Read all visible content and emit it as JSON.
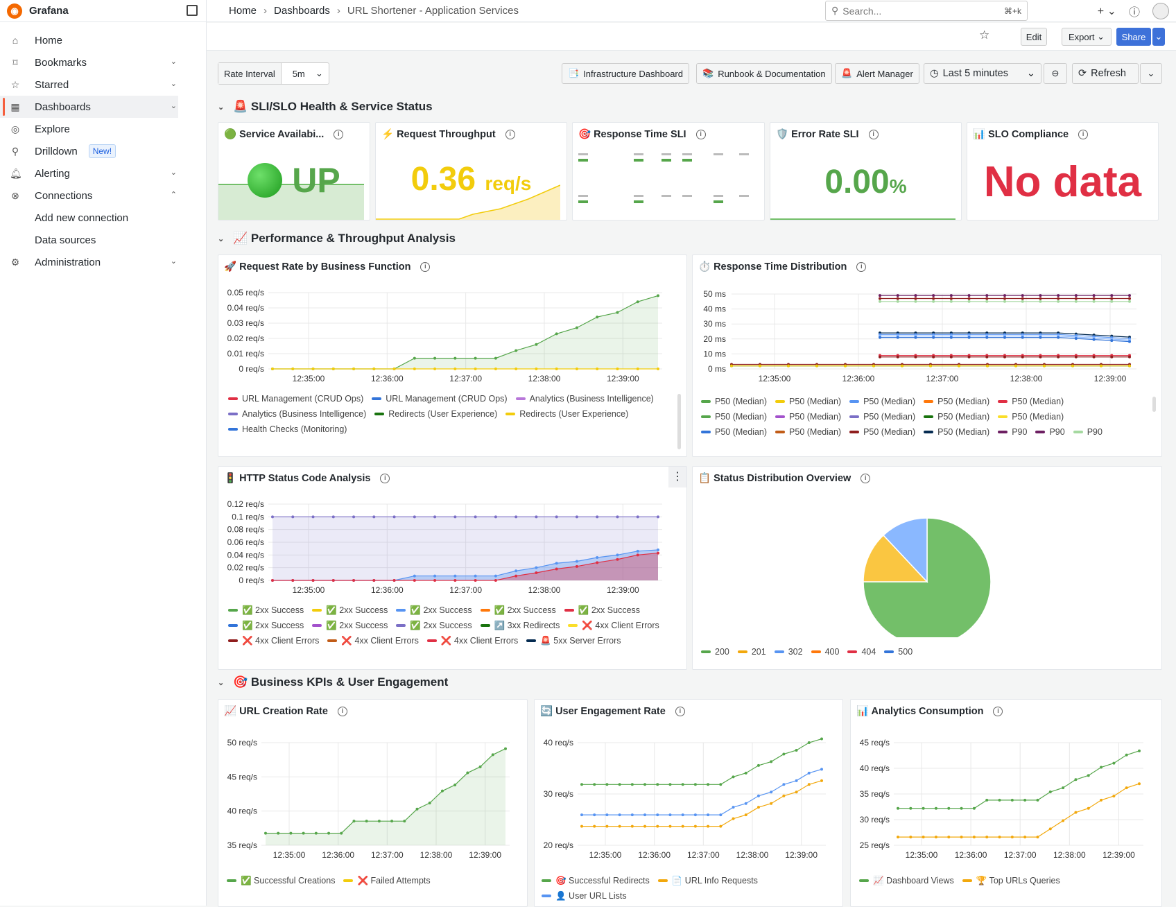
{
  "app": {
    "name": "Grafana"
  },
  "sidebar": {
    "items": [
      {
        "label": "Home",
        "icon": "home-icon"
      },
      {
        "label": "Bookmarks",
        "icon": "bookmark-icon"
      },
      {
        "label": "Starred",
        "icon": "star-icon"
      },
      {
        "label": "Dashboards",
        "icon": "dashboards-icon"
      },
      {
        "label": "Explore",
        "icon": "compass-icon"
      },
      {
        "label": "Drilldown",
        "icon": "drilldown-icon",
        "badge": "New!"
      },
      {
        "label": "Alerting",
        "icon": "bell-icon"
      },
      {
        "label": "Connections",
        "icon": "connections-icon"
      },
      {
        "label": "Add new connection"
      },
      {
        "label": "Data sources"
      },
      {
        "label": "Administration",
        "icon": "gear-icon"
      }
    ]
  },
  "breadcrumb": {
    "home": "Home",
    "dashboards": "Dashboards",
    "current": "URL Shortener - Application Services"
  },
  "search": {
    "placeholder": "Search...",
    "shortcut": "⌘+k"
  },
  "toolbar": {
    "edit": "Edit",
    "export": "Export",
    "share": "Share"
  },
  "vars": {
    "rate_label": "Rate Interval",
    "rate_value": "5m"
  },
  "links": {
    "infra": "Infrastructure Dashboard",
    "runbook": "Runbook & Documentation",
    "alert": "Alert Manager"
  },
  "time": {
    "range": "Last 5 minutes",
    "refresh": "Refresh"
  },
  "rows": {
    "r1": "🚨 SLI/SLO Health & Service Status",
    "r2": "📈 Performance & Throughput Analysis",
    "r3": "🎯 Business KPIs & User Engagement"
  },
  "stats": {
    "availability": {
      "title": "🟢 Service Availabi...",
      "value": "UP"
    },
    "throughput": {
      "title": "⚡ Request Throughput",
      "value": "0.36",
      "unit": "req/s"
    },
    "response": {
      "title": "🎯 Response Time SLI"
    },
    "error": {
      "title": "🛡️ Error Rate SLI",
      "value": "0.00",
      "unit": "%"
    },
    "slo": {
      "title": "📊 SLO Compliance",
      "value": "No data"
    }
  },
  "panels": {
    "reqrate": {
      "title": "🚀 Request Rate by Business Function"
    },
    "resp": {
      "title": "⏱️ Response Time Distribution"
    },
    "http": {
      "title": "🚦 HTTP Status Code Analysis"
    },
    "statusdist": {
      "title": "📋 Status Distribution Overview"
    },
    "urlcreate": {
      "title": "📈 URL Creation Rate"
    },
    "engagement": {
      "title": "🔄 User Engagement Rate"
    },
    "analytics": {
      "title": "📊 Analytics Consumption"
    }
  },
  "colors": {
    "green": "#56a64b",
    "yellow": "#f2cc0c",
    "blue": "#5794f2",
    "red": "#e02f44",
    "orange": "#ff780a",
    "purple": "#b877d9",
    "darkred": "#8f1d1d",
    "lightgreen": "#96d98d"
  },
  "chart_data": [
    {
      "id": "reqrate",
      "type": "line",
      "x": [
        "12:35:00",
        "12:36:00",
        "12:37:00",
        "12:38:00",
        "12:39:00"
      ],
      "yticks": [
        "0.05 req/s",
        "0.04 req/s",
        "0.03 req/s",
        "0.02 req/s",
        "0.01 req/s",
        "0 req/s"
      ],
      "ylim": [
        0,
        0.05
      ],
      "series": [
        {
          "values": [
            0,
            0,
            0,
            0,
            0,
            0,
            0,
            0.007,
            0.007,
            0.007,
            0.007,
            0.007,
            0.012,
            0.016,
            0.023,
            0.027,
            0.034,
            0.037,
            0.044,
            0.048
          ],
          "color": "#56a64b"
        },
        {
          "values": [
            0,
            0,
            0,
            0,
            0,
            0,
            0,
            0,
            0,
            0,
            0,
            0,
            0,
            0,
            0,
            0,
            0,
            0,
            0,
            0
          ],
          "color": "#f2cc0c"
        }
      ],
      "legend": [
        "URL Management (CRUD Ops)",
        "URL Management (CRUD Ops)",
        "Analytics (Business Intelligence)",
        "Analytics (Business Intelligence)",
        "Redirects (User Experience)",
        "Redirects (User Experience)",
        "Health Checks (Monitoring)"
      ]
    },
    {
      "id": "resp",
      "type": "line",
      "x": [
        "12:35:00",
        "12:36:00",
        "12:37:00",
        "12:38:00",
        "12:39:00"
      ],
      "yticks": [
        "50 ms",
        "40 ms",
        "30 ms",
        "20 ms",
        "10 ms",
        "0 ms"
      ],
      "ylim": [
        0,
        50
      ],
      "legend": [
        "P50 (Median)",
        "P50 (Median)",
        "P50 (Median)",
        "P50 (Median)",
        "P50 (Median)",
        "P50 (Median)",
        "P50 (Median)",
        "P50 (Median)",
        "P50 (Median)",
        "P50 (Median)",
        "P50 (Median)",
        "P50 (Median)",
        "P50 (Median)",
        "P50 (Median)",
        "P90",
        "P90",
        "P90"
      ]
    },
    {
      "id": "http",
      "type": "area",
      "x": [
        "12:35:00",
        "12:36:00",
        "12:37:00",
        "12:38:00",
        "12:39:00"
      ],
      "yticks": [
        "0.12 req/s",
        "0.1 req/s",
        "0.08 req/s",
        "0.06 req/s",
        "0.04 req/s",
        "0.02 req/s",
        "0 req/s"
      ],
      "ylim": [
        0,
        0.12
      ],
      "series": [
        {
          "name": "2xx Success",
          "values": [
            0.1,
            0.1,
            0.1,
            0.1,
            0.1,
            0.1,
            0.1,
            0.1,
            0.1,
            0.1,
            0.1,
            0.1,
            0.1,
            0.1,
            0.1,
            0.1,
            0.1,
            0.1,
            0.1,
            0.1
          ],
          "color": "#7b6fc6"
        },
        {
          "name": "2xx Success",
          "values": [
            0,
            0,
            0,
            0,
            0,
            0,
            0,
            0.007,
            0.007,
            0.007,
            0.007,
            0.007,
            0.015,
            0.02,
            0.027,
            0.03,
            0.036,
            0.04,
            0.046,
            0.048
          ],
          "color": "#5794f2"
        },
        {
          "name": "4xx Client Errors",
          "values": [
            0,
            0,
            0,
            0,
            0,
            0,
            0,
            0,
            0,
            0,
            0,
            0,
            0.007,
            0.012,
            0.018,
            0.022,
            0.028,
            0.033,
            0.04,
            0.043
          ],
          "color": "#e02f44"
        }
      ],
      "legend": [
        "✅ 2xx Success",
        "✅ 2xx Success",
        "✅ 2xx Success",
        "✅ 2xx Success",
        "✅ 2xx Success",
        "✅ 2xx Success",
        "✅ 2xx Success",
        "✅ 2xx Success",
        "↗️ 3xx Redirects",
        "❌ 4xx Client Errors",
        "❌ 4xx Client Errors",
        "❌ 4xx Client Errors",
        "❌ 4xx Client Errors",
        "🚨 5xx Server Errors"
      ]
    },
    {
      "id": "statusdist",
      "type": "pie",
      "slices": [
        {
          "label": "200",
          "value": 75,
          "color": "#73bf69"
        },
        {
          "label": "201",
          "value": 13,
          "color": "#fac641"
        },
        {
          "label": "302",
          "value": 12,
          "color": "#8ab8ff"
        }
      ],
      "legend": [
        "200",
        "201",
        "302",
        "400",
        "404",
        "500"
      ]
    },
    {
      "id": "urlcreate",
      "type": "line",
      "x": [
        "12:35:00",
        "12:36:00",
        "12:37:00",
        "12:38:00",
        "12:39:00"
      ],
      "yticks": [
        "50 req/s",
        "45 req/s",
        "40 req/s",
        "35 req/s"
      ],
      "ylim": [
        34,
        51
      ],
      "series": [
        {
          "name": "✅ Successful Creations",
          "values": [
            36,
            36,
            36,
            36,
            36,
            36,
            36,
            38,
            38,
            38,
            38,
            38,
            40,
            41,
            43,
            44,
            46,
            47,
            49,
            50
          ],
          "color": "#56a64b"
        }
      ],
      "legend": [
        "✅ Successful Creations",
        "❌ Failed Attempts"
      ]
    },
    {
      "id": "engagement",
      "type": "line",
      "x": [
        "12:35:00",
        "12:36:00",
        "12:37:00",
        "12:38:00",
        "12:39:00"
      ],
      "yticks": [
        "40 req/s",
        "30 req/s",
        "20 req/s"
      ],
      "ylim": [
        18,
        45
      ],
      "series": [
        {
          "name": "🎯 Successful Redirects",
          "values": [
            34,
            34,
            34,
            34,
            34,
            34,
            34,
            34,
            34,
            34,
            34,
            34,
            36,
            37,
            39,
            40,
            42,
            43,
            45,
            46
          ],
          "color": "#56a64b"
        },
        {
          "name": "👤 User URL Lists",
          "values": [
            26,
            26,
            26,
            26,
            26,
            26,
            26,
            26,
            26,
            26,
            26,
            26,
            28,
            29,
            31,
            32,
            34,
            35,
            37,
            38
          ],
          "color": "#5794f2"
        },
        {
          "name": "📄 URL Info Requests",
          "values": [
            23,
            23,
            23,
            23,
            23,
            23,
            23,
            23,
            23,
            23,
            23,
            23,
            25,
            26,
            28,
            29,
            31,
            32,
            34,
            35
          ],
          "color": "#f2a80c"
        }
      ],
      "legend": [
        "🎯 Successful Redirects",
        "📄 URL Info Requests",
        "👤 User URL Lists"
      ]
    },
    {
      "id": "analytics",
      "type": "line",
      "x": [
        "12:35:00",
        "12:36:00",
        "12:37:00",
        "12:38:00",
        "12:39:00"
      ],
      "yticks": [
        "45 req/s",
        "40 req/s",
        "35 req/s",
        "30 req/s",
        "25 req/s"
      ],
      "ylim": [
        22,
        47
      ],
      "series": [
        {
          "name": "📈 Dashboard Views",
          "values": [
            31,
            31,
            31,
            31,
            31,
            31,
            31,
            33,
            33,
            33,
            33,
            33,
            35,
            36,
            38,
            39,
            41,
            42,
            44,
            45
          ],
          "color": "#56a64b"
        },
        {
          "name": "🏆 Top URLs Queries",
          "values": [
            24,
            24,
            24,
            24,
            24,
            24,
            24,
            24,
            24,
            24,
            24,
            24,
            26,
            28,
            30,
            31,
            33,
            34,
            36,
            37
          ],
          "color": "#f2a80c"
        }
      ],
      "legend": [
        "📈 Dashboard Views",
        "🏆 Top URLs Queries"
      ]
    }
  ]
}
